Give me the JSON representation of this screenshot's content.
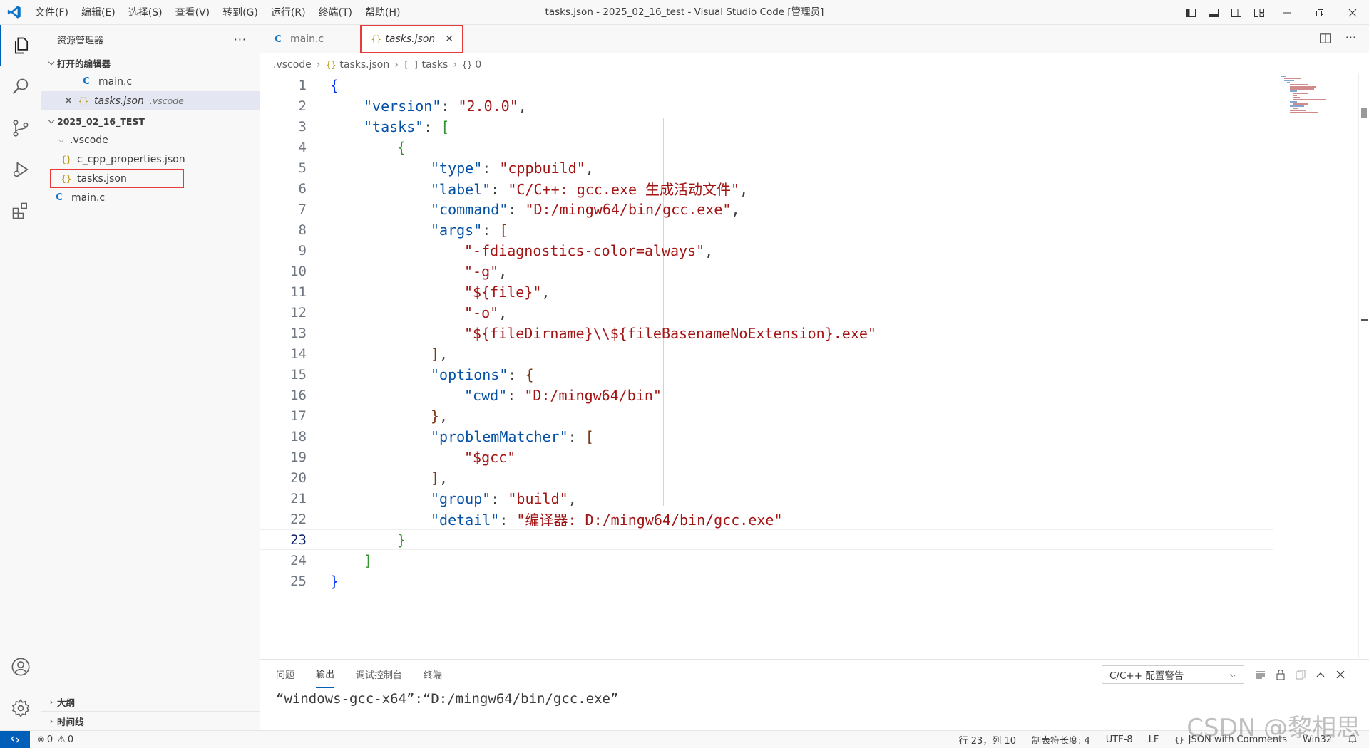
{
  "titlebar": {
    "title": "tasks.json - 2025_02_16_test - Visual Studio Code [管理员]",
    "menu": [
      "文件(F)",
      "编辑(E)",
      "选择(S)",
      "查看(V)",
      "转到(G)",
      "运行(R)",
      "终端(T)",
      "帮助(H)"
    ]
  },
  "sidebar": {
    "title": "资源管理器",
    "open_editors_label": "打开的编辑器",
    "open_editors": [
      {
        "name": "main.c",
        "type": "c"
      },
      {
        "name": "tasks.json",
        "folder": ".vscode",
        "type": "json"
      }
    ],
    "folder_label": "2025_02_16_TEST",
    "tree": {
      "vscode_folder": ".vscode",
      "c_cpp_properties": "c_cpp_properties.json",
      "tasks": "tasks.json",
      "mainc": "main.c"
    },
    "outline_label": "大纲",
    "timeline_label": "时间线"
  },
  "tabs": [
    {
      "label": "main.c",
      "active": false
    },
    {
      "label": "tasks.json",
      "active": true
    }
  ],
  "breadcrumb": [
    ".vscode",
    "tasks.json",
    "tasks",
    "0"
  ],
  "editor": {
    "current_line": 23,
    "lines": [
      {
        "n": "1",
        "code": "{"
      },
      {
        "n": "2",
        "code": "\"version\": \"2.0.0\","
      },
      {
        "n": "3",
        "code": "\"tasks\": ["
      },
      {
        "n": "4",
        "code": "{"
      },
      {
        "n": "5",
        "code": "\"type\": \"cppbuild\","
      },
      {
        "n": "6",
        "code": "\"label\": \"C/C++: gcc.exe 生成活动文件\","
      },
      {
        "n": "7",
        "code": "\"command\": \"D:/mingw64/bin/gcc.exe\","
      },
      {
        "n": "8",
        "code": "\"args\": ["
      },
      {
        "n": "9",
        "code": "\"-fdiagnostics-color=always\","
      },
      {
        "n": "10",
        "code": "\"-g\","
      },
      {
        "n": "11",
        "code": "\"${file}\","
      },
      {
        "n": "12",
        "code": "\"-o\","
      },
      {
        "n": "13",
        "code": "\"${fileDirname}\\\\${fileBasenameNoExtension}.exe\""
      },
      {
        "n": "14",
        "code": "],"
      },
      {
        "n": "15",
        "code": "\"options\": {"
      },
      {
        "n": "16",
        "code": "\"cwd\": \"D:/mingw64/bin\""
      },
      {
        "n": "17",
        "code": "},"
      },
      {
        "n": "18",
        "code": "\"problemMatcher\": ["
      },
      {
        "n": "19",
        "code": "\"$gcc\""
      },
      {
        "n": "20",
        "code": "],"
      },
      {
        "n": "21",
        "code": "\"group\": \"build\","
      },
      {
        "n": "22",
        "code": "\"detail\": \"编译器: D:/mingw64/bin/gcc.exe\""
      },
      {
        "n": "23",
        "code": "}"
      },
      {
        "n": "24",
        "code": "]"
      },
      {
        "n": "25",
        "code": "}"
      }
    ]
  },
  "panel": {
    "tabs": [
      "问题",
      "输出",
      "调试控制台",
      "终端"
    ],
    "active_tab": "输出",
    "channel": "C/C++ 配置警告",
    "output_line": "“windows-gcc-x64”:“D:/mingw64/bin/gcc.exe”"
  },
  "statusbar": {
    "errors": "0",
    "warnings": "0",
    "position": "行 23，列 10",
    "tab_size": "制表符长度: 4",
    "encoding": "UTF-8",
    "eol": "LF",
    "language": "JSON with Comments",
    "platform": "Win32"
  },
  "watermark": "CSDN @黎相思",
  "colors": {
    "accent": "#005fb8",
    "highlight_box": "#e83a3a",
    "json_key": "#0451a5",
    "json_string": "#a31515"
  }
}
